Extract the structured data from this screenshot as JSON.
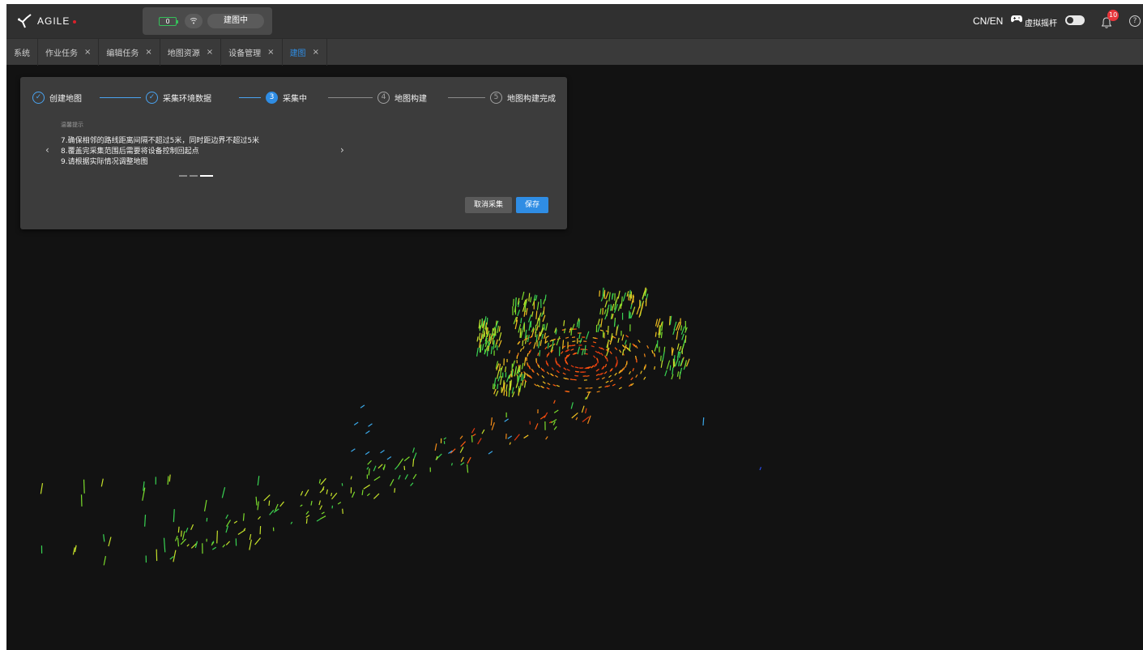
{
  "app": {
    "logo_text": "AGILE"
  },
  "status": {
    "battery": "0",
    "mode": "建图中"
  },
  "header": {
    "lang": "CN/EN",
    "joystick_label": "虚拟摇杆",
    "notifications": "10",
    "help": "?"
  },
  "tabs": [
    {
      "label": "系统",
      "closable": false
    },
    {
      "label": "作业任务",
      "closable": true
    },
    {
      "label": "编辑任务",
      "closable": true
    },
    {
      "label": "地图资源",
      "closable": true
    },
    {
      "label": "设备管理",
      "closable": true
    },
    {
      "label": "建图",
      "closable": true,
      "active": true
    }
  ],
  "tab_close": "×",
  "wizard": {
    "steps": [
      {
        "num": "✓",
        "label": "创建地图",
        "state": "done"
      },
      {
        "num": "✓",
        "label": "采集环境数据",
        "state": "done"
      },
      {
        "num": "3",
        "label": "采集中",
        "state": "active"
      },
      {
        "num": "4",
        "label": "地图构建",
        "state": "pending"
      },
      {
        "num": "5",
        "label": "地图构建完成",
        "state": "pending"
      }
    ],
    "tips_title": "温馨提示",
    "tips": [
      "7.确保相邻的路线距离间隔不超过5米，同时距边界不超过5米",
      "8.覆盖完采集范围后需要将设备控制回起点",
      "9.请根据实际情况调整地图"
    ],
    "prev": "‹",
    "next": "›",
    "cancel_label": "取消采集",
    "save_label": "保存"
  },
  "colors": {
    "accent": "#2f8de4",
    "badge": "#e8353b",
    "battery": "#35c05a"
  }
}
